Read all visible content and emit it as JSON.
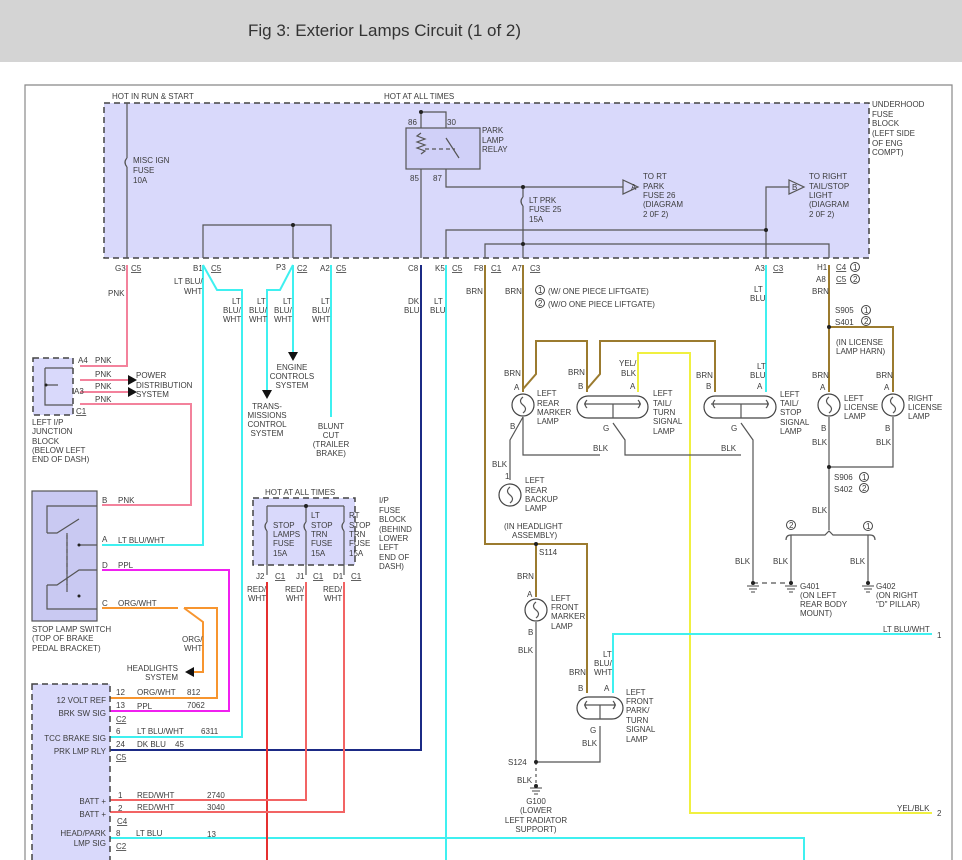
{
  "header": {
    "title": "Fig 3: Exterior Lamps Circuit (1 of 2)"
  },
  "colors": {
    "pnk": "#f3829c",
    "lt_blu": "#3ff0f0",
    "brn": "#9b7b2f",
    "dk_blu": "#1b2a85",
    "ppl": "#f020f0",
    "org": "#f7952f",
    "yel": "#f0f040",
    "red": "#e53030",
    "block_fill": "#d9d9fb"
  },
  "top": {
    "hot_run": "HOT IN RUN & START",
    "hot_all": "HOT AT ALL TIMES"
  },
  "ufb": {
    "l1": "UNDERHOOD",
    "l2": "FUSE",
    "l3": "BLOCK",
    "l4": "(LEFT SIDE",
    "l5": "OF ENG",
    "l6": "COMPT)"
  },
  "misc_fuse": {
    "l1": "MISC IGN",
    "l2": "FUSE",
    "l3": "10A"
  },
  "relay": {
    "p86": "86",
    "p30": "30",
    "p85": "85",
    "p87": "87",
    "l1": "PARK",
    "l2": "LAMP",
    "l3": "RELAY"
  },
  "lt_prk": {
    "l1": "LT PRK",
    "l2": "FUSE 25",
    "l3": "15A"
  },
  "to_a": {
    "tag": "A",
    "l1": "TO RT",
    "l2": "PARK",
    "l3": "FUSE 26",
    "l4": "(DIAGRAM",
    "l5": "2 0F 2)"
  },
  "to_b": {
    "tag": "B",
    "l1": "TO RIGHT",
    "l2": "TAIL/STOP",
    "l3": "LIGHT",
    "l4": "(DIAGRAM",
    "l5": "2 0F 2)"
  },
  "conn": {
    "g3": "G3",
    "c5": "C5",
    "b1": "B1",
    "p3": "P3",
    "c2": "C2",
    "a2": "A2",
    "c8": "C8",
    "k5": "K5",
    "f8": "F8",
    "c1": "C1",
    "a7": "A7",
    "c3": "C3",
    "a3": "A3",
    "h1": "H1",
    "c4": "C4",
    "a8": "A8",
    "n1": "1",
    "n2": "2"
  },
  "notes": {
    "n1": "(W/ ONE PIECE LIFTGATE)",
    "n2": "(W/O ONE PIECE LIFTGATE)"
  },
  "wires": {
    "pnk": "PNK",
    "lt_blu_wht": "LT BLU/",
    "wht": "WHT",
    "lt": "LT",
    "blu_": "BLU/",
    "dk": "DK",
    "blu": "BLU",
    "brn": "BRN",
    "blk": "BLK",
    "yel": "YEL/",
    "lt_blu_wht_full": "LT BLU/WHT",
    "yel_blk": "YEL/BLK",
    "ppl": "PPL",
    "org_wht": "ORG/WHT",
    "org": "ORG/",
    "red": "RED/",
    "red_wht": "RED/WHT",
    "lt_blu": "LT BLU",
    "dk_blu": "DK BLU"
  },
  "jb": {
    "a4": "A4",
    "a3": "A3",
    "c1": "C1",
    "l1": "LEFT I/P",
    "l2": "JUNCTION",
    "l3": "BLOCK",
    "l4": "(BELOW LEFT",
    "l5": "END OF DASH)"
  },
  "pds": {
    "l1": "POWER",
    "l2": "DISTRIBUTION",
    "l3": "SYSTEM"
  },
  "ecs": {
    "l1": "ENGINE",
    "l2": "CONTROLS",
    "l3": "SYSTEM"
  },
  "tcs": {
    "l1": "TRANS-",
    "l2": "MISSIONS",
    "l3": "CONTROL",
    "l4": "SYSTEM"
  },
  "blunt": {
    "l1": "BLUNT",
    "l2": "CUT",
    "l3": "(TRAILER",
    "l4": "BRAKE)"
  },
  "pins": {
    "a": "A",
    "b": "B",
    "c": "C",
    "d": "D",
    "g": "G",
    "one": "1"
  },
  "lamps": {
    "rear_marker": [
      "LEFT",
      "REAR",
      "MARKER",
      "LAMP"
    ],
    "tail_turn": [
      "LEFT",
      "TAIL/",
      "TURN",
      "SIGNAL",
      "LAMP"
    ],
    "tail_stop": [
      "LEFT",
      "TAIL/",
      "STOP",
      "SIGNAL",
      "LAMP"
    ],
    "lic_left": [
      "LEFT",
      "LICENSE",
      "LAMP"
    ],
    "lic_right": [
      "RIGHT",
      "LICENSE",
      "LAMP"
    ],
    "backup": [
      "LEFT",
      "REAR",
      "BACKUP",
      "LAMP"
    ],
    "front_marker": [
      "LEFT",
      "FRONT",
      "MARKER",
      "LAMP"
    ],
    "front_park": [
      "LEFT",
      "FRONT",
      "PARK/",
      "TURN",
      "SIGNAL",
      "LAMP"
    ]
  },
  "splices": {
    "s905": "S905",
    "s401": "S401",
    "s906": "S906",
    "s402": "S402",
    "s114": "S114",
    "s124": "S124",
    "lic_harn1": "(IN LICENSE",
    "lic_harn2": "LAMP HARN)",
    "hl1": "(IN HEADLIGHT",
    "hl2": "ASSEMBLY)"
  },
  "grounds": {
    "g401": [
      "G401",
      "(ON LEFT",
      "REAR BODY",
      "MOUNT)"
    ],
    "g402": [
      "G402",
      "(ON RIGHT",
      "\"D\" PILLAR)"
    ],
    "g100": [
      "G100",
      "(LOWER",
      "LEFT RADIATOR",
      "SUPPORT)"
    ]
  },
  "sls": {
    "l1": "STOP LAMP SWITCH",
    "l2": "(TOP OF BRAKE",
    "l3": "PEDAL BRACKET)"
  },
  "hls": {
    "l1": "HEADLIGHTS",
    "l2": "SYSTEM"
  },
  "ipfb": {
    "hot": "HOT AT ALL TIMES",
    "f1": [
      "STOP",
      "LAMPS",
      "FUSE",
      "15A"
    ],
    "f2": [
      "LT",
      "STOP",
      "TRN",
      "FUSE",
      "15A"
    ],
    "f3": [
      "RT",
      "STOP",
      "TRN",
      "FUSE",
      "15A"
    ],
    "lbl": [
      "I/P",
      "FUSE",
      "BLOCK",
      "(BEHIND",
      "LOWER",
      "LEFT",
      "END OF",
      "DASH)"
    ],
    "j2": "J2",
    "j1": "J1",
    "d1": "D1",
    "c1": "C1"
  },
  "pcm": {
    "rows": [
      {
        "name": "12 VOLT REF",
        "pin": "12",
        "wire": "ORG/WHT",
        "circuit": "812"
      },
      {
        "name": "BRK SW SIG",
        "pin": "13",
        "wire": "PPL",
        "circuit": "7062"
      },
      {
        "name": "TCC BRAKE SIG",
        "pin": "6",
        "wire": "LT BLU/WHT",
        "circuit": "6311"
      },
      {
        "name": "PRK LMP RLY",
        "pin": "24",
        "wire": "DK BLU",
        "circuit": "45"
      },
      {
        "name": "BATT +",
        "pin": "1",
        "wire": "RED/WHT",
        "circuit": "2740"
      },
      {
        "name": "BATT +",
        "pin": "2",
        "wire": "RED/WHT",
        "circuit": "3040"
      },
      {
        "name": "HEAD/PARK",
        "name2": "LMP SIG",
        "pin": "8",
        "wire": "LT BLU",
        "circuit": "13"
      }
    ],
    "c2": "C2",
    "c5": "C5",
    "c4": "C4"
  },
  "offpage": {
    "o1": "1",
    "o2": "2"
  }
}
